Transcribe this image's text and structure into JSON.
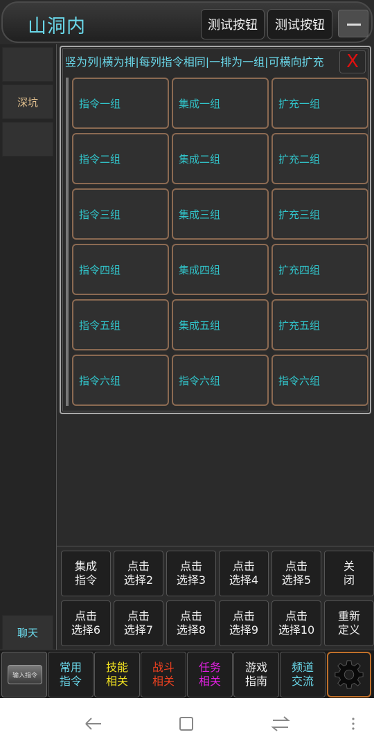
{
  "header": {
    "title": "山洞内",
    "buttons": [
      "测试按钮",
      "测试按钮"
    ]
  },
  "sidebar": {
    "items": [
      "",
      "深坑",
      ""
    ],
    "chat_label": "聊天"
  },
  "panel": {
    "description": "竖为列|横为排|每列指令相同|一排为一组|可横向扩充",
    "close_label": "X",
    "rows": [
      [
        "指令一组",
        "集成一组",
        "扩充一组"
      ],
      [
        "指令二组",
        "集成二组",
        "扩充二组"
      ],
      [
        "指令三组",
        "集成三组",
        "扩充三组"
      ],
      [
        "指令四组",
        "集成四组",
        "扩充四组"
      ],
      [
        "指令五组",
        "集成五组",
        "扩充五组"
      ],
      [
        "指令六组",
        "指令六组",
        "指令六组"
      ]
    ]
  },
  "actions": {
    "row1": [
      "集成\n指令",
      "点击\n选择2",
      "点击\n选择3",
      "点击\n选择4",
      "点击\n选择5",
      "关\n闭"
    ],
    "row2": [
      "点击\n选择6",
      "点击\n选择7",
      "点击\n选择8",
      "点击\n选择9",
      "点击\n选择10",
      "重新\n定义"
    ]
  },
  "bottombar": {
    "input_label": "输入指令",
    "buttons": [
      {
        "label": "常用\n指令",
        "color": "#6ad8ea"
      },
      {
        "label": "技能\n相关",
        "color": "#f0e020"
      },
      {
        "label": "战斗\n相关",
        "color": "#e84020"
      },
      {
        "label": "任务\n相关",
        "color": "#e020e0"
      },
      {
        "label": "游戏\n指南",
        "color": "#f0f0f0"
      },
      {
        "label": "频道\n交流",
        "color": "#6ad8ea"
      }
    ],
    "settings_icon": "gear-icon"
  },
  "sysnav": {
    "icons": [
      "back-icon",
      "recents-icon",
      "switch-icon",
      "menu-icon"
    ]
  }
}
